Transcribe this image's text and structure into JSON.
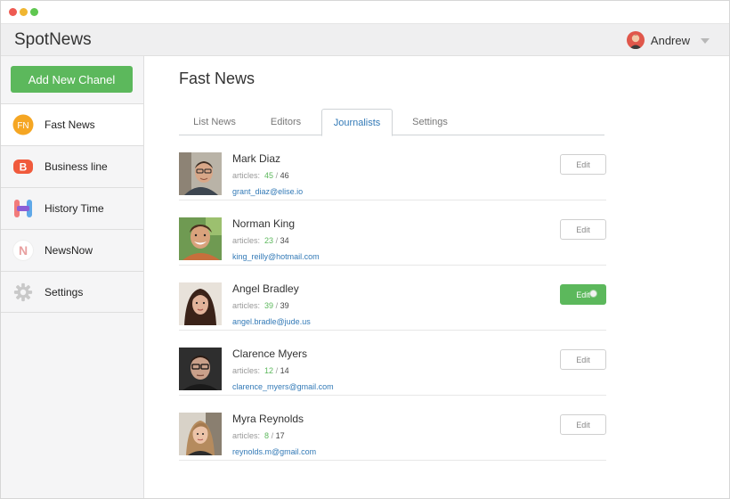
{
  "app": {
    "title": "SpotNews"
  },
  "user": {
    "name": "Andrew"
  },
  "sidebar": {
    "add_button": "Add New Chanel",
    "items": [
      {
        "label": "Fast News",
        "icon": "fast-news-logo-icon",
        "active": true
      },
      {
        "label": "Business line",
        "icon": "business-line-logo-icon"
      },
      {
        "label": "History Time",
        "icon": "history-time-logo-icon"
      },
      {
        "label": "NewsNow",
        "icon": "newsnow-logo-icon"
      },
      {
        "label": "Settings",
        "icon": "gear-icon"
      }
    ],
    "logos": {
      "fast_news": "FN",
      "business": "B",
      "newsnow": "N"
    }
  },
  "main": {
    "title": "Fast News",
    "tabs": [
      {
        "label": "List News"
      },
      {
        "label": "Editors"
      },
      {
        "label": "Journalists",
        "active": true
      },
      {
        "label": "Settings"
      }
    ]
  },
  "journalists": [
    {
      "name": "Mark Diaz",
      "articles_prefix": "articles:",
      "done": "45",
      "total": "46",
      "email": "grant_diaz@elise.io",
      "edit": "Edit"
    },
    {
      "name": "Norman King",
      "articles_prefix": "articles:",
      "done": "23",
      "total": "34",
      "email": "king_reilly@hotmail.com",
      "edit": "Edit"
    },
    {
      "name": "Angel Bradley",
      "articles_prefix": "articles:",
      "done": "39",
      "total": "39",
      "email": "angel.bradle@jude.us",
      "edit": "Edit"
    },
    {
      "name": "Clarence Myers",
      "articles_prefix": "articles:",
      "done": "12",
      "total": "14",
      "email": "clarence_myers@gmail.com",
      "edit": "Edit"
    },
    {
      "name": "Myra Reynolds",
      "articles_prefix": "articles:",
      "done": "8",
      "total": "17",
      "email": "reynolds.m@gmail.com",
      "edit": "Edit"
    }
  ],
  "separator": "/",
  "colors": {
    "accent_green": "#5cb85c",
    "link_blue": "#337ab7",
    "fast_news_orange": "#f5a623",
    "business_red": "#f05a3c",
    "newsnow_pink": "#e8a0a0"
  }
}
